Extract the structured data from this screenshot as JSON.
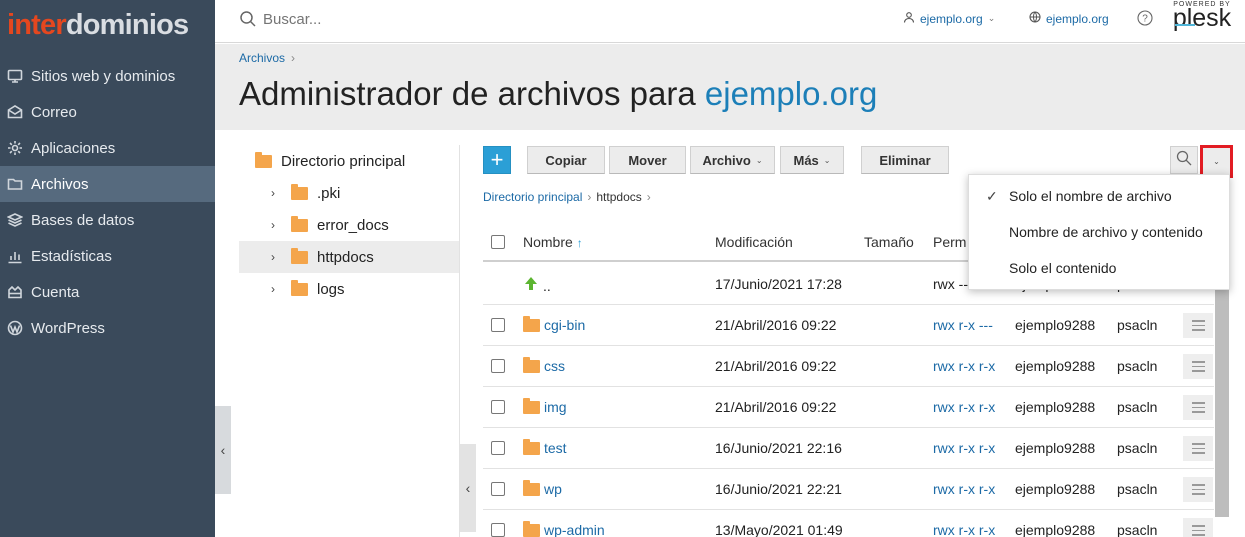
{
  "brand": {
    "part1": "inter",
    "part2": "dominios"
  },
  "sidebar": {
    "items": [
      {
        "label": "Sitios web y dominios",
        "icon": "monitor-icon"
      },
      {
        "label": "Correo",
        "icon": "mail-icon"
      },
      {
        "label": "Aplicaciones",
        "icon": "gear-icon"
      },
      {
        "label": "Archivos",
        "icon": "folder-icon",
        "active": true
      },
      {
        "label": "Bases de datos",
        "icon": "layers-icon"
      },
      {
        "label": "Estadísticas",
        "icon": "bar-chart-icon"
      },
      {
        "label": "Cuenta",
        "icon": "account-icon"
      },
      {
        "label": "WordPress",
        "icon": "wordpress-icon"
      }
    ]
  },
  "header": {
    "search_placeholder": "Buscar...",
    "user_label": "ejemplo.org",
    "domain_label": "ejemplo.org",
    "powered_by": "POWERED BY",
    "plesk": "plesk"
  },
  "page": {
    "breadcrumb": "Archivos",
    "title_prefix": "Administrador de archivos para ",
    "title_domain": "ejemplo.org"
  },
  "tree": {
    "root": "Directorio principal",
    "children": [
      ".pki",
      "error_docs",
      "httpdocs",
      "logs"
    ],
    "selected": "httpdocs"
  },
  "toolbar": {
    "add": "+",
    "copy": "Copiar",
    "move": "Mover",
    "file": "Archivo",
    "more": "Más",
    "delete": "Eliminar"
  },
  "path": {
    "root": "Directorio principal",
    "current": "httpdocs"
  },
  "table": {
    "columns": {
      "name": "Nombre",
      "modified": "Modificación",
      "size": "Tamaño",
      "perms": "Perm"
    },
    "parent": {
      "name": "..",
      "modified": "17/Junio/2021 17:28",
      "perms": "rwx ---",
      "user": "ejemplo9288",
      "group": "psacln"
    },
    "rows": [
      {
        "name": "cgi-bin",
        "modified": "21/Abril/2016 09:22",
        "perms": "rwx r-x ---",
        "user": "ejemplo9288",
        "group": "psacln"
      },
      {
        "name": "css",
        "modified": "21/Abril/2016 09:22",
        "perms": "rwx r-x r-x",
        "user": "ejemplo9288",
        "group": "psacln"
      },
      {
        "name": "img",
        "modified": "21/Abril/2016 09:22",
        "perms": "rwx r-x r-x",
        "user": "ejemplo9288",
        "group": "psacln"
      },
      {
        "name": "test",
        "modified": "16/Junio/2021 22:16",
        "perms": "rwx r-x r-x",
        "user": "ejemplo9288",
        "group": "psacln"
      },
      {
        "name": "wp",
        "modified": "16/Junio/2021 22:21",
        "perms": "rwx r-x r-x",
        "user": "ejemplo9288",
        "group": "psacln"
      },
      {
        "name": "wp-admin",
        "modified": "13/Mayo/2021 01:49",
        "perms": "rwx r-x r-x",
        "user": "ejemplo9288",
        "group": "psacln"
      }
    ]
  },
  "search_options": {
    "items": [
      "Solo el nombre de archivo",
      "Nombre de archivo y contenido",
      "Solo el contenido"
    ],
    "selected": "Solo el nombre de archivo",
    "check": "✓"
  },
  "colors": {
    "sidebar": "#3a4a5b",
    "accent": "#1c6aa6",
    "brand_red": "#e4471f",
    "highlight": "#e21c23"
  }
}
